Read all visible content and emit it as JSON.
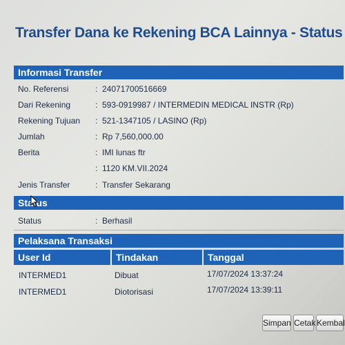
{
  "page": {
    "title": "Transfer Dana ke Rekening BCA Lainnya - Status Transaksi"
  },
  "informasi_transfer": {
    "header": "Informasi Transfer",
    "separator": ":",
    "rows": [
      {
        "label": "No. Referensi",
        "value": "24071700516669"
      },
      {
        "label": "Dari Rekening",
        "value": "593-0919987 / INTERMEDIN MEDICAL INSTR  (Rp)"
      },
      {
        "label": "Rekening Tujuan",
        "value": "521-1347105 / LASINO  (Rp)"
      },
      {
        "label": "Jumlah",
        "value": "Rp  7,560,000.00"
      },
      {
        "label": "Berita",
        "value": "IMI lunas ftr"
      },
      {
        "label": "",
        "value": "1120 KM.VII.2024"
      },
      {
        "label": "Jenis Transfer",
        "value": "Transfer Sekarang"
      }
    ]
  },
  "status": {
    "header": "Status",
    "label": "Status",
    "value": "Berhasil"
  },
  "pelaksana": {
    "header": "Pelaksana Transaksi",
    "columns": [
      "User Id",
      "Tindakan",
      "Tanggal"
    ],
    "rows": [
      {
        "user_id": "INTERMED1",
        "tindakan": "Dibuat",
        "tanggal": "17/07/2024 13:37:24"
      },
      {
        "user_id": "INTERMED1",
        "tindakan": "Diotorisasi",
        "tanggal": "17/07/2024 13:39:11"
      }
    ]
  },
  "buttons": {
    "simpan": "Simpan",
    "cetak": "Cetak",
    "kembali": "Kembali"
  },
  "colors": {
    "header_bar": "#1e63b8",
    "title": "#1f4c8f"
  }
}
